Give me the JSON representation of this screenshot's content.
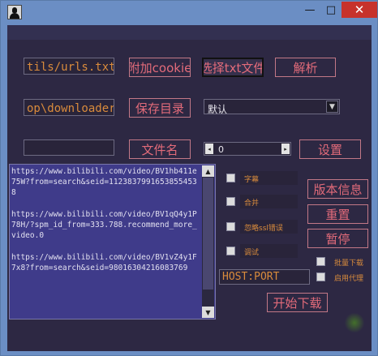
{
  "window": {
    "minimize": "—",
    "maximize": "□",
    "close": "✕"
  },
  "urls_file": "tils/urls.txt",
  "output_dir": "op\\downloader",
  "filename_input": "",
  "buttons": {
    "append_cookie": "附加cookie",
    "choose_txt": "选择txt文件",
    "parse": "解析",
    "save_dir": "保存目录",
    "file_name": "文件名",
    "settings": "设置",
    "version_info": "版本信息",
    "reset": "重置",
    "pause": "暂停",
    "start_download": "开始下载"
  },
  "quality_select": "默认",
  "spinner_value": "0",
  "log_text": "https://www.bilibili.com/video/BV1hb411e75W?from=search&seid=11238379916538554538\n\nhttps://www.bilibili.com/video/BV1qQ4y1P78H/?spm_id_from=333.788.recommend_more_video.0\n\nhttps://www.bilibili.com/video/BV1vZ4y1F7x8?from=search&seid=9801630421608376​9",
  "options": {
    "subtitles": "字幕",
    "merge": "合并",
    "ignore_ssl": "忽略ssl错误",
    "debug": "调试",
    "batch_download": "批量下载",
    "enable_proxy": "启用代理"
  },
  "proxy": "HOST:PORT"
}
